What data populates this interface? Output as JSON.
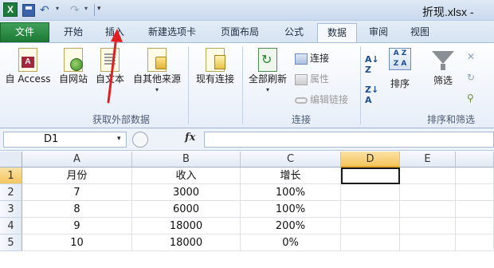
{
  "titlebar": {
    "app_icon_letter": "X",
    "file_title": "折现.xlsx -",
    "quick_access": [
      "save-icon",
      "undo-icon",
      "redo-icon"
    ]
  },
  "tabs": [
    {
      "label": "文件"
    },
    {
      "label": "开始"
    },
    {
      "label": "插入"
    },
    {
      "label": "新建选项卡"
    },
    {
      "label": "页面布局"
    },
    {
      "label": "公式"
    },
    {
      "label": "数据"
    },
    {
      "label": "审阅"
    },
    {
      "label": "视图"
    }
  ],
  "active_tab": "数据",
  "ribbon": {
    "get_external": {
      "group_label": "获取外部数据",
      "access": "自 Access",
      "web": "自网站",
      "text": "自文本",
      "other": "自其他来源",
      "existing": "现有连接"
    },
    "connections": {
      "group_label": "连接",
      "refresh_all": "全部刷新",
      "connections": "连接",
      "properties": "属性",
      "edit_links": "编辑链接"
    },
    "sort_filter": {
      "group_label": "排序和筛选",
      "sort": "排序",
      "filter": "筛选",
      "sort_icon_text": "A Z Z A"
    }
  },
  "formula_bar": {
    "name_box": "D1",
    "fx_label": "fx",
    "formula": ""
  },
  "sheet": {
    "columns": [
      "A",
      "B",
      "C",
      "D",
      "E"
    ],
    "active_column": "D",
    "active_row": "1",
    "rows": [
      {
        "num": "1",
        "cells": [
          "月份",
          "收入",
          "增长",
          "",
          ""
        ]
      },
      {
        "num": "2",
        "cells": [
          "7",
          "3000",
          "100%",
          "",
          ""
        ]
      },
      {
        "num": "3",
        "cells": [
          "8",
          "6000",
          "100%",
          "",
          ""
        ]
      },
      {
        "num": "4",
        "cells": [
          "9",
          "18000",
          "200%",
          "",
          ""
        ]
      },
      {
        "num": "5",
        "cells": [
          "10",
          "18000",
          "0%",
          "",
          ""
        ]
      }
    ]
  },
  "colors": {
    "file_tab": "#1d7a35",
    "active_header": "#f4c65e",
    "annotation_arrow": "#e02020"
  }
}
